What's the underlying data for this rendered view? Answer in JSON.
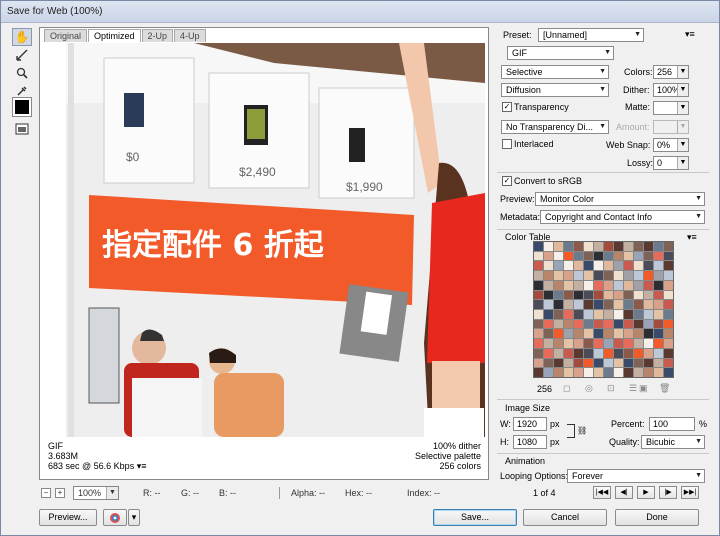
{
  "window": {
    "title": "Save for Web (100%)"
  },
  "tabs": [
    "Original",
    "Optimized",
    "2-Up",
    "4-Up"
  ],
  "icons": {
    "hand": "hand-tool-icon",
    "slice": "slice-select-tool-icon",
    "zoom": "zoom-tool-icon",
    "eyedropper": "eyedropper-tool-icon",
    "toggle": "toggle-slices-icon"
  },
  "image_info": {
    "format": "GIF",
    "size": "3.683M",
    "time": "683 sec @ 56.6 Kbps",
    "dither": "100% dither",
    "palette": "Selective palette",
    "colors": "256 colors"
  },
  "photo": {
    "banner_text": "指定配件 6 折起",
    "price_1": "$0",
    "price_2": "$2,490",
    "price_3": "$1,990"
  },
  "status": {
    "zoom": "100%",
    "r": "R: --",
    "g": "G: --",
    "b": "B: --",
    "alpha": "Alpha: --",
    "hex": "Hex: --",
    "index": "Index: --"
  },
  "buttons": {
    "preview": "Preview...",
    "save": "Save...",
    "cancel": "Cancel",
    "done": "Done"
  },
  "settings": {
    "preset_label": "Preset:",
    "preset_value": "[Unnamed]",
    "format": "GIF",
    "reduction": "Selective",
    "colors_label": "Colors:",
    "colors_value": "256",
    "dither_algo": "Diffusion",
    "dither_label": "Dither:",
    "dither_value": "100%",
    "transparency_label": "Transparency",
    "matte_label": "Matte:",
    "transparency_dither": "No Transparency Di...",
    "amount_label": "Amount:",
    "interlaced_label": "Interlaced",
    "websnap_label": "Web Snap:",
    "websnap_value": "0%",
    "lossy_label": "Lossy:",
    "lossy_value": "0",
    "convert_label": "Convert to sRGB",
    "preview_label": "Preview:",
    "preview_value": "Monitor Color",
    "metadata_label": "Metadata:",
    "metadata_value": "Copyright and Contact Info"
  },
  "color_table": {
    "title": "Color Table",
    "count": "256"
  },
  "image_size": {
    "title": "Image Size",
    "w_label": "W:",
    "w_value": "1920",
    "h_label": "H:",
    "h_value": "1080",
    "unit": "px",
    "percent_label": "Percent:",
    "percent_value": "100",
    "percent_unit": "%",
    "quality_label": "Quality:",
    "quality_value": "Bicubic"
  },
  "animation": {
    "title": "Animation",
    "looping_label": "Looping Options:",
    "looping_value": "Forever",
    "frame": "1 of 4"
  },
  "colors": {
    "accent": "#3c7fb1",
    "banner": "#f25a2a"
  }
}
